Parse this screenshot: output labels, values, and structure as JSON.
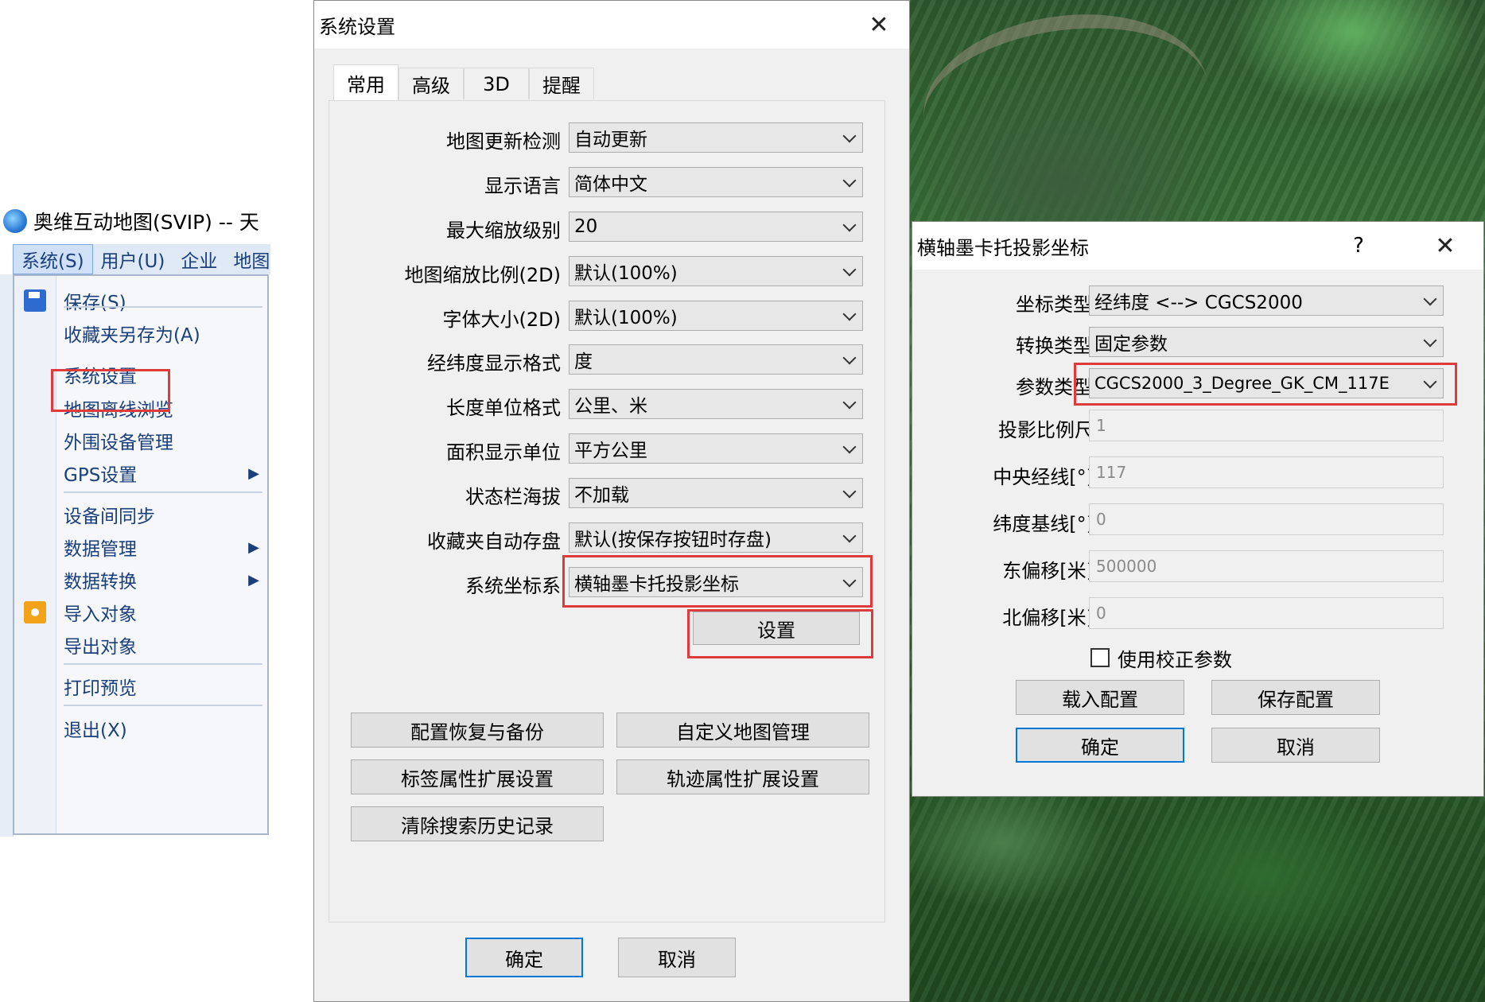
{
  "app": {
    "title": "奥维互动地图(SVIP) -- 天",
    "menubar": [
      "系统(S)",
      "用户(U)",
      "企业",
      "地图"
    ],
    "menu_items": {
      "save": "保存(S)",
      "save_favorites_as": "收藏夹另存为(A)",
      "system_settings": "系统设置",
      "offline_browse": "地图离线浏览",
      "peripheral": "外围设备管理",
      "gps": "GPS设置",
      "sync": "设备间同步",
      "data_mgmt": "数据管理",
      "data_convert": "数据转换",
      "import": "导入对象",
      "export": "导出对象",
      "print_preview": "打印预览",
      "exit": "退出(X)"
    }
  },
  "settings_dialog": {
    "title": "系统设置",
    "tabs": [
      "常用",
      "高级",
      "3D",
      "提醒"
    ],
    "rows": [
      {
        "label": "地图更新检测",
        "value": "自动更新"
      },
      {
        "label": "显示语言",
        "value": "简体中文"
      },
      {
        "label": "最大缩放级别",
        "value": "20"
      },
      {
        "label": "地图缩放比例(2D)",
        "value": "默认(100%)"
      },
      {
        "label": "字体大小(2D)",
        "value": "默认(100%)"
      },
      {
        "label": "经纬度显示格式",
        "value": "度"
      },
      {
        "label": "长度单位格式",
        "value": "公里、米"
      },
      {
        "label": "面积显示单位",
        "value": "平方公里"
      },
      {
        "label": "状态栏海拔",
        "value": "不加载"
      },
      {
        "label": "收藏夹自动存盘",
        "value": "默认(按保存按钮时存盘)"
      },
      {
        "label": "系统坐标系",
        "value": "横轴墨卡托投影坐标"
      }
    ],
    "setup_button": "设置",
    "buttons": {
      "restore_backup": "配置恢复与备份",
      "custom_map": "自定义地图管理",
      "label_attr": "标签属性扩展设置",
      "track_attr": "轨迹属性扩展设置",
      "clear_history": "清除搜索历史记录"
    },
    "ok": "确定",
    "cancel": "取消",
    "close_icon": "close-icon"
  },
  "proj_dialog": {
    "title": "横轴墨卡托投影坐标",
    "help": "?",
    "combos": [
      {
        "label": "坐标类型",
        "value": "经纬度 <--> CGCS2000"
      },
      {
        "label": "转换类型",
        "value": "固定参数"
      },
      {
        "label": "参数类型",
        "value": "CGCS2000_3_Degree_GK_CM_117E"
      }
    ],
    "fields": [
      {
        "label": "投影比例尺",
        "value": "1"
      },
      {
        "label": "中央经线[°]",
        "value": "117"
      },
      {
        "label": "纬度基线[°]",
        "value": "0"
      },
      {
        "label": "东偏移[米]",
        "value": "500000"
      },
      {
        "label": "北偏移[米]",
        "value": "0"
      }
    ],
    "checkbox_label": "使用校正参数",
    "load_config": "载入配置",
    "save_config": "保存配置",
    "ok": "确定",
    "cancel": "取消"
  }
}
